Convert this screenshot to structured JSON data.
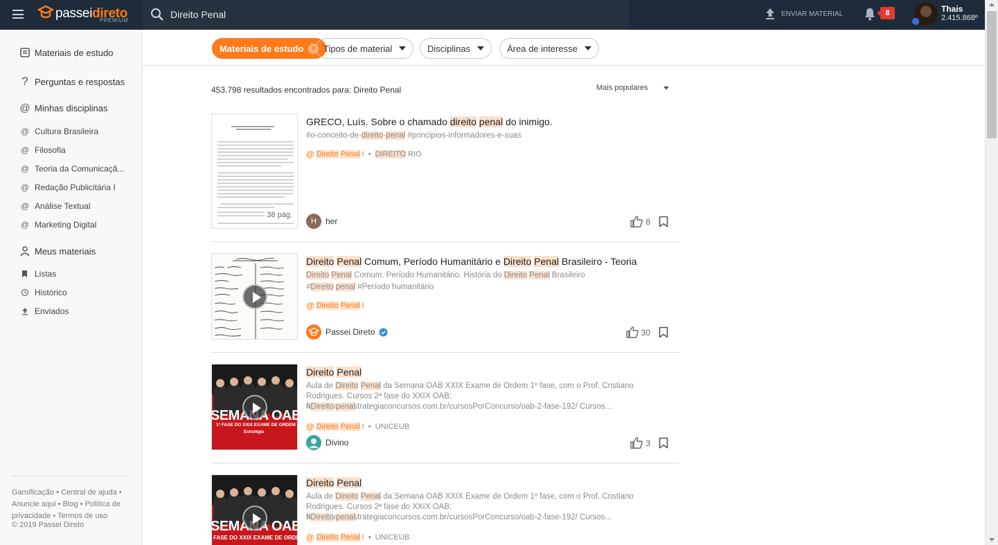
{
  "header": {
    "logo_word_a": "passei",
    "logo_word_b": "direto",
    "logo_sub": "PREMIUM",
    "search_value": "Direito Penal",
    "upload_label": "ENVIAR MATERIAL",
    "notif_count": "8",
    "user_name": "Thais",
    "user_points": "2.415.868º"
  },
  "sidebar": {
    "main_items": [
      {
        "label": "Materiais de estudo",
        "icon": "document-icon"
      },
      {
        "label": "Perguntas e respostas",
        "icon": "question-icon"
      },
      {
        "label": "Minhas disciplinas",
        "icon": "at-icon"
      }
    ],
    "disciplines": [
      "Cultura Brasileira",
      "Filosofia",
      "Teoria da Comunicaçã...",
      "Redação Publicitária I",
      "Análise Textual",
      "Marketing Digital"
    ],
    "my_materials_label": "Meus materiais",
    "material_items": [
      {
        "label": "Listas",
        "icon": "bookmark-icon"
      },
      {
        "label": "Histórico",
        "icon": "history-icon"
      },
      {
        "label": "Enviados",
        "icon": "upload-icon"
      }
    ],
    "footer_links": [
      "Gamificação",
      "Central de ajuda",
      "Anuncie aqui",
      "Blog",
      "Política de privacidade",
      "Termos de uso"
    ],
    "copyright": "© 2019 Passei Direto"
  },
  "filters": {
    "active": "Materiais de estudo",
    "types": "Tipos de material",
    "disciplines": "Disciplinas",
    "area": "Área de interesse"
  },
  "results": {
    "count": "453.798",
    "text": "resultados encontrados para:",
    "query": "Direito Penal",
    "sort": "Mais populares"
  },
  "cards": [
    {
      "title_pre": "GRECO, Luís. Sobre o chamado ",
      "title_hl1": "direito",
      "title_sp": " ",
      "title_hl2": "penal",
      "title_post": " do inimigo.",
      "tags_pre": "#o-conceito-de-",
      "tags_hl1": "direito",
      "tags_mid": "-",
      "tags_hl2": "penal",
      "tags_post": " #principios-informadores-e-suas",
      "disc_hl1": "Direito",
      "disc_hl2": "Penal",
      "disc_post": " I",
      "inst_hl": "DIREITO",
      "inst_post": " RIO",
      "pages": "38 pág.",
      "author": "her",
      "author_initial": "H",
      "likes": "8"
    },
    {
      "title_hl1": "Direito",
      "title_hl2": "Penal",
      "title_mid": " Comum, Período Humanitário e ",
      "title_hl3": "Direito",
      "title_hl4": "Penal",
      "title_post": " Brasileiro - Teoria",
      "d1_hl1": "Direito",
      "d1_hl2": "Penal",
      "d1_mid": " Comum. Período Humanitário. História do ",
      "d1_hl3": "Direito",
      "d1_hl4": "Penal",
      "d1_post": " Brasileiro",
      "d2_pre": "#",
      "d2_hl1": "Direito",
      "d2_hl2": "penal",
      "d2_post": " #Período humanitário",
      "disc_hl1": "Direito",
      "disc_hl2": "Penal",
      "disc_post": " I",
      "author": "Passei Direto",
      "likes": "30"
    },
    {
      "title_hl1": "Direito",
      "title_hl2": "Penal",
      "d_pre": "Aula de ",
      "d_hl1": "Direito",
      "d_hl2": "Penal",
      "d_post": " da Semana OAB XXIX Exame de Ordem 1º fase, com o Prof. Cristiano Rodrigues. Cursos 2ª fase do XXIX OAB: https://www.estrategiaconcursos.com.br/cursosPorConcurso/oab-2-fase-192/ Cursos...",
      "tag_pre": "#",
      "tag_hl1": "Direito",
      "tag_hl2": "penal",
      "disc_hl1": "Direito",
      "disc_hl2": "Penal",
      "disc_post": " I",
      "inst": "UNICEUB",
      "thumb_big": "SEMANA OAB",
      "thumb_sub": "1ª FASE DO XXIX EXAME DE ORDEM",
      "thumb_brand": "Estratégia",
      "author": "Divino",
      "likes": "3"
    },
    {
      "title_hl1": "Direito",
      "title_hl2": "Penal",
      "d_pre": "Aula de ",
      "d_hl1": "Direito",
      "d_hl2": "Penal",
      "d_post": " da Semana OAB XXIX Exame de Ordem 1º fase, com o Prof. Cristiano Rodrigues. Cursos 2ª fase do XXIX OAB: https://www.estrategiaconcursos.com.br/cursosPorConcurso/oab-2-fase-192/ Cursos...",
      "tag_pre": "#",
      "tag_hl1": "Direito",
      "tag_hl2": "penal",
      "disc_hl1": "Direito",
      "disc_hl2": "Penal",
      "disc_post": " I",
      "inst": "UNICEUB",
      "thumb_big": "SEMANA OAB",
      "thumb_sub": "FASE DO XXIX EXAME DE ORDEM"
    }
  ],
  "colors": {
    "brand": "#ff7a1a",
    "topbar": "#1d2b3a",
    "highlight": "#fbe0cc",
    "badge": "#e03b2f"
  }
}
